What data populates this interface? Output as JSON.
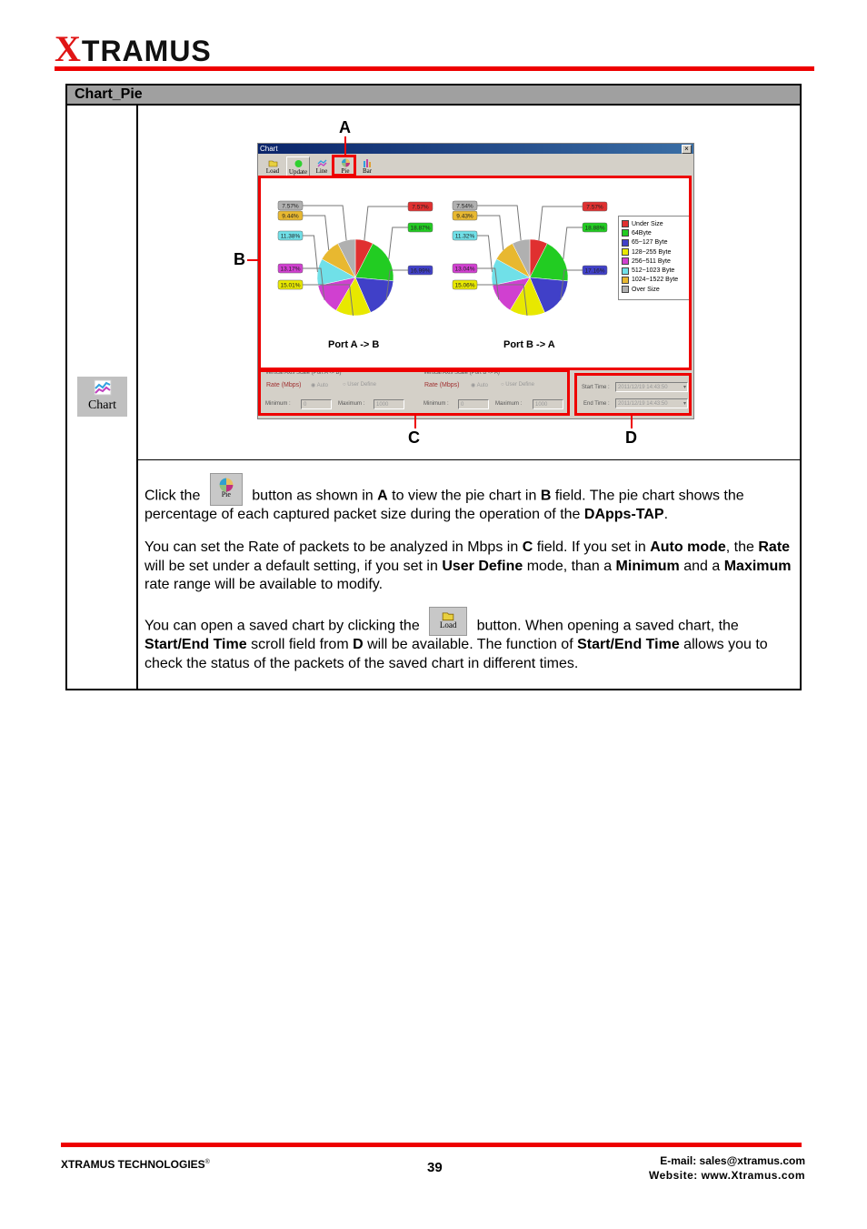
{
  "header": {
    "logo_x": "X",
    "logo_rest": "TRAMUS",
    "brand_color": "#ee0000"
  },
  "table": {
    "title": "Chart_Pie",
    "icon_label": "Chart"
  },
  "window": {
    "title": "Chart",
    "toolbar": [
      {
        "label": "Load",
        "icon": "folder-open-icon"
      },
      {
        "label": "Update",
        "icon": "green-dot-icon"
      },
      {
        "label": "Line",
        "icon": "line-chart-icon"
      },
      {
        "label": "Pie",
        "icon": "pie-chart-icon"
      },
      {
        "label": "Bar",
        "icon": "bar-chart-icon"
      }
    ],
    "close_glyph": "×",
    "vertical_axis_a": {
      "title": "Vertical Axis Scale (Port A -> B)",
      "rate_label": "Rate (Mbps)",
      "auto_label": "Auto",
      "user_define_label": "User Define",
      "min_label": "Minimum :",
      "min_value": "0",
      "max_label": "Maximum :",
      "max_value": "1000"
    },
    "vertical_axis_b": {
      "title": "Vertical Axis Scale (Port B -> A)",
      "rate_label": "Rate (Mbps)",
      "auto_label": "Auto",
      "user_define_label": "User Define",
      "min_label": "Minimum :",
      "min_value": "0",
      "max_label": "Maximum :",
      "max_value": "1000"
    },
    "time": {
      "start_label": "Start Time :",
      "start_value": "2011/12/19 14:43:50",
      "end_label": "End Time :",
      "end_value": "2011/12/19 14:43:50"
    }
  },
  "callouts": {
    "a": "A",
    "b": "B",
    "c": "C",
    "d": "D"
  },
  "chart_data": [
    {
      "type": "pie",
      "title": "Port A -> B",
      "categories": [
        "Under Size",
        "64Byte",
        "65~127 Byte",
        "128~255 Byte",
        "256~511 Byte",
        "512~1023 Byte",
        "1024~1522 Byte",
        "Over Size"
      ],
      "values": [
        7.57,
        18.87,
        16.99,
        15.01,
        13.17,
        11.38,
        9.44,
        7.57
      ],
      "labels": [
        "7.57%",
        "18.87%",
        "16.99%",
        "15.01%",
        "13.17%",
        "11.38%",
        "9.44%",
        "7.57%"
      ],
      "colors": [
        "#e03030",
        "#22cc22",
        "#4040c8",
        "#e8e800",
        "#d040d0",
        "#70e0e8",
        "#e8b830",
        "#b0b0b0"
      ],
      "legend_position": "top-right"
    },
    {
      "type": "pie",
      "title": "Port B -> A",
      "categories": [
        "Under Size",
        "64Byte",
        "65~127 Byte",
        "128~255 Byte",
        "256~511 Byte",
        "512~1023 Byte",
        "1024~1522 Byte",
        "Over Size"
      ],
      "values": [
        7.57,
        18.88,
        17.16,
        15.06,
        13.04,
        11.32,
        9.43,
        7.54
      ],
      "labels": [
        "7.57%",
        "18.88%",
        "17.16%",
        "15.06%",
        "13.04%",
        "11.32%",
        "9.43%",
        "7.54%"
      ],
      "colors": [
        "#e03030",
        "#22cc22",
        "#4040c8",
        "#e8e800",
        "#d040d0",
        "#70e0e8",
        "#e8b830",
        "#b0b0b0"
      ],
      "legend_position": "top-right"
    }
  ],
  "body": {
    "p1": {
      "t1": "Click the",
      "icon_label": "Pie",
      "t2": "button as shown in",
      "b1": "A",
      "t3": "to view the pie chart in",
      "b2": "B",
      "t4": "field. The pie chart shows the percentage of each captured packet size during the operation of the",
      "b3": "DApps-TAP",
      "t5": "."
    },
    "p2": {
      "t1": "You can set the Rate of packets to be analyzed in Mbps in",
      "b1": "C",
      "t2": "field. If you set in",
      "b2": "Auto mode",
      "t3": ", the",
      "b3": "Rate",
      "t4": "will be set under a default setting, if you set in",
      "b4": "User Define",
      "t5": "mode, than a",
      "b5": "Minimum",
      "t6": "and a",
      "b6": "Maximum",
      "t7": "rate range will be available to modify."
    },
    "p3": {
      "t1": "You can open a saved chart by clicking the",
      "icon_label": "Load",
      "t2": "button. When opening a saved chart, the",
      "b1": "Start/End Time",
      "t3": "scroll field from",
      "b2": "D",
      "t4": "will be available. The function of",
      "b3": "Start/End Time",
      "t5": "allows you to check the status of the packets of the saved chart in different times."
    }
  },
  "footer": {
    "company": "XTRAMUS TECHNOLOGIES",
    "registered": "®",
    "page": "39",
    "email": "E-mail: sales@xtramus.com",
    "website": "Website:  www.Xtramus.com"
  }
}
